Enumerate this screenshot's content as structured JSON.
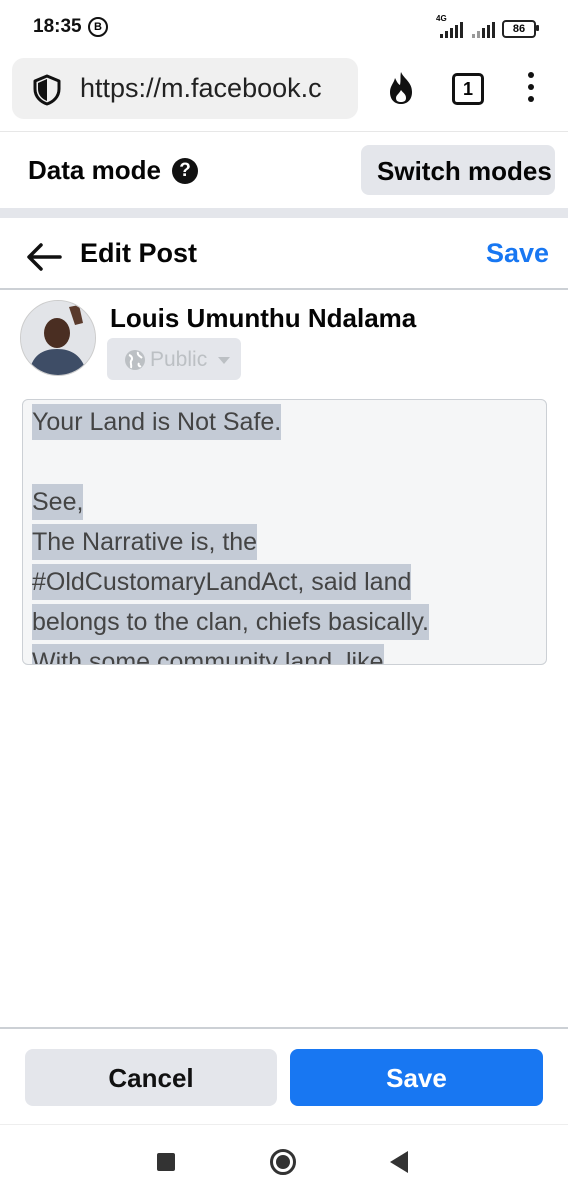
{
  "status_bar": {
    "time": "18:35",
    "notification_badge": "B",
    "network": "4G",
    "battery": "86"
  },
  "browser": {
    "url": "https://m.facebook.c",
    "tab_count": "1"
  },
  "data_mode": {
    "label": "Data mode",
    "help": "?",
    "switch_label": "Switch modes"
  },
  "header": {
    "title": "Edit Post",
    "save_label": "Save"
  },
  "author": {
    "name": "Louis Umunthu Ndalama",
    "audience": "Public"
  },
  "post": {
    "lines": [
      "Your Land is Not Safe.",
      "",
      "See,",
      "The Narrative is, the",
      "#OldCustomaryLandAct, said land",
      "belongs to the clan, chiefs basically.",
      "With some community land, like"
    ]
  },
  "footer": {
    "cancel_label": "Cancel",
    "save_label": "Save"
  },
  "colors": {
    "accent": "#1877f2",
    "button_gray": "#e4e6eb",
    "selection": "#c4cbd6"
  }
}
